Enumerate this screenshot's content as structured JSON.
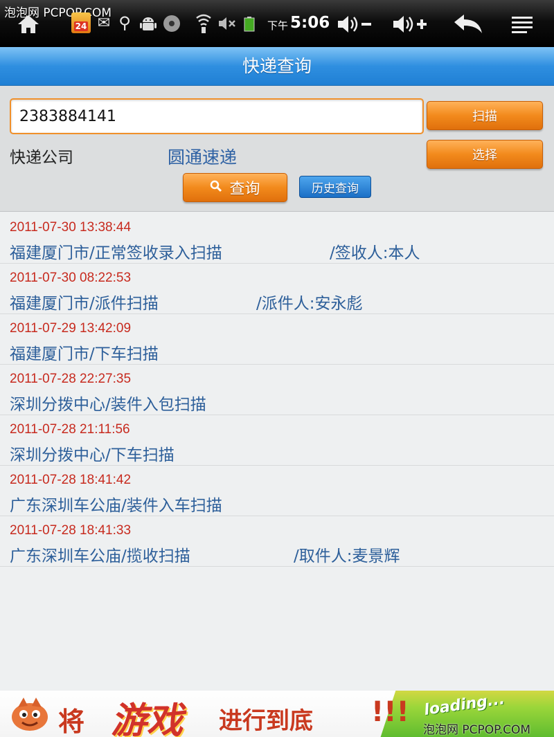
{
  "watermark": {
    "top": "泡泡网 PCPOP.COM",
    "bottom": "泡泡网 PCPOP.COM"
  },
  "status_bar": {
    "calendar_badge": "24",
    "ampm": "下午",
    "time": "5:06",
    "icons": [
      "home-icon",
      "calendar-icon",
      "mail-icon",
      "usb-icon",
      "android-icon",
      "disc-icon",
      "wifi-icon",
      "mute-icon",
      "battery-icon",
      "volume-down-icon",
      "volume-up-icon",
      "back-icon",
      "menu-icon"
    ]
  },
  "header": {
    "title": "快递查询"
  },
  "search": {
    "tracking_number": "2383884141",
    "scan_label": "扫描",
    "choose_label": "选择",
    "company_label": "快递公司",
    "company_value": "圆通速递",
    "query_label": "查询",
    "history_label": "历史查询"
  },
  "results": [
    {
      "time": "2011-07-30 13:38:44",
      "place": "福建厦门市/正常签收录入扫描",
      "person": "/签收人:本人"
    },
    {
      "time": "2011-07-30 08:22:53",
      "place": "福建厦门市/派件扫描",
      "person": "/派件人:安永彪"
    },
    {
      "time": "2011-07-29 13:42:09",
      "place": "福建厦门市/下车扫描",
      "person": ""
    },
    {
      "time": "2011-07-28 22:27:35",
      "place": "深圳分拨中心/装件入包扫描",
      "person": ""
    },
    {
      "time": "2011-07-28 21:11:56",
      "place": "深圳分拨中心/下车扫描",
      "person": ""
    },
    {
      "time": "2011-07-28 18:41:42",
      "place": "广东深圳车公庙/装件入车扫描",
      "person": ""
    },
    {
      "time": "2011-07-28 18:41:33",
      "place": "广东深圳车公庙/揽收扫描",
      "person": "/取件人:麦景辉"
    }
  ],
  "banner": {
    "text_1": "将",
    "text_2": "游戏",
    "text_3": "进行到底",
    "text_4": "!!!",
    "text_5": "loading..."
  },
  "colors": {
    "accent_orange": "#f28a1c",
    "title_blue": "#2f8fe0",
    "time_red": "#c72a1e",
    "text_blue": "#2d5f9a"
  }
}
